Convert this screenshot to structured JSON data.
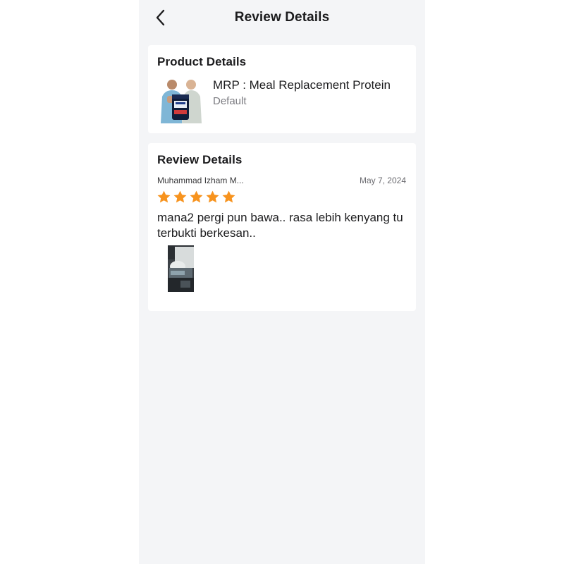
{
  "header": {
    "title": "Review Details",
    "back_icon": "chevron-left-icon"
  },
  "product_card": {
    "title": "Product Details",
    "product_name": "MRP : Meal Replacement Protein",
    "variant": "Default"
  },
  "review_card": {
    "title": "Review Details",
    "reviewer_name": "Muhammad Izham M...",
    "date": "May 7, 2024",
    "rating": 5,
    "rating_max": 5,
    "text": "mana2 pergi pun bawa.. rasa lebih kenyang tu terbukti berkesan.."
  },
  "colors": {
    "star": "#f7931e",
    "background": "#f4f5f7",
    "card": "#ffffff"
  }
}
